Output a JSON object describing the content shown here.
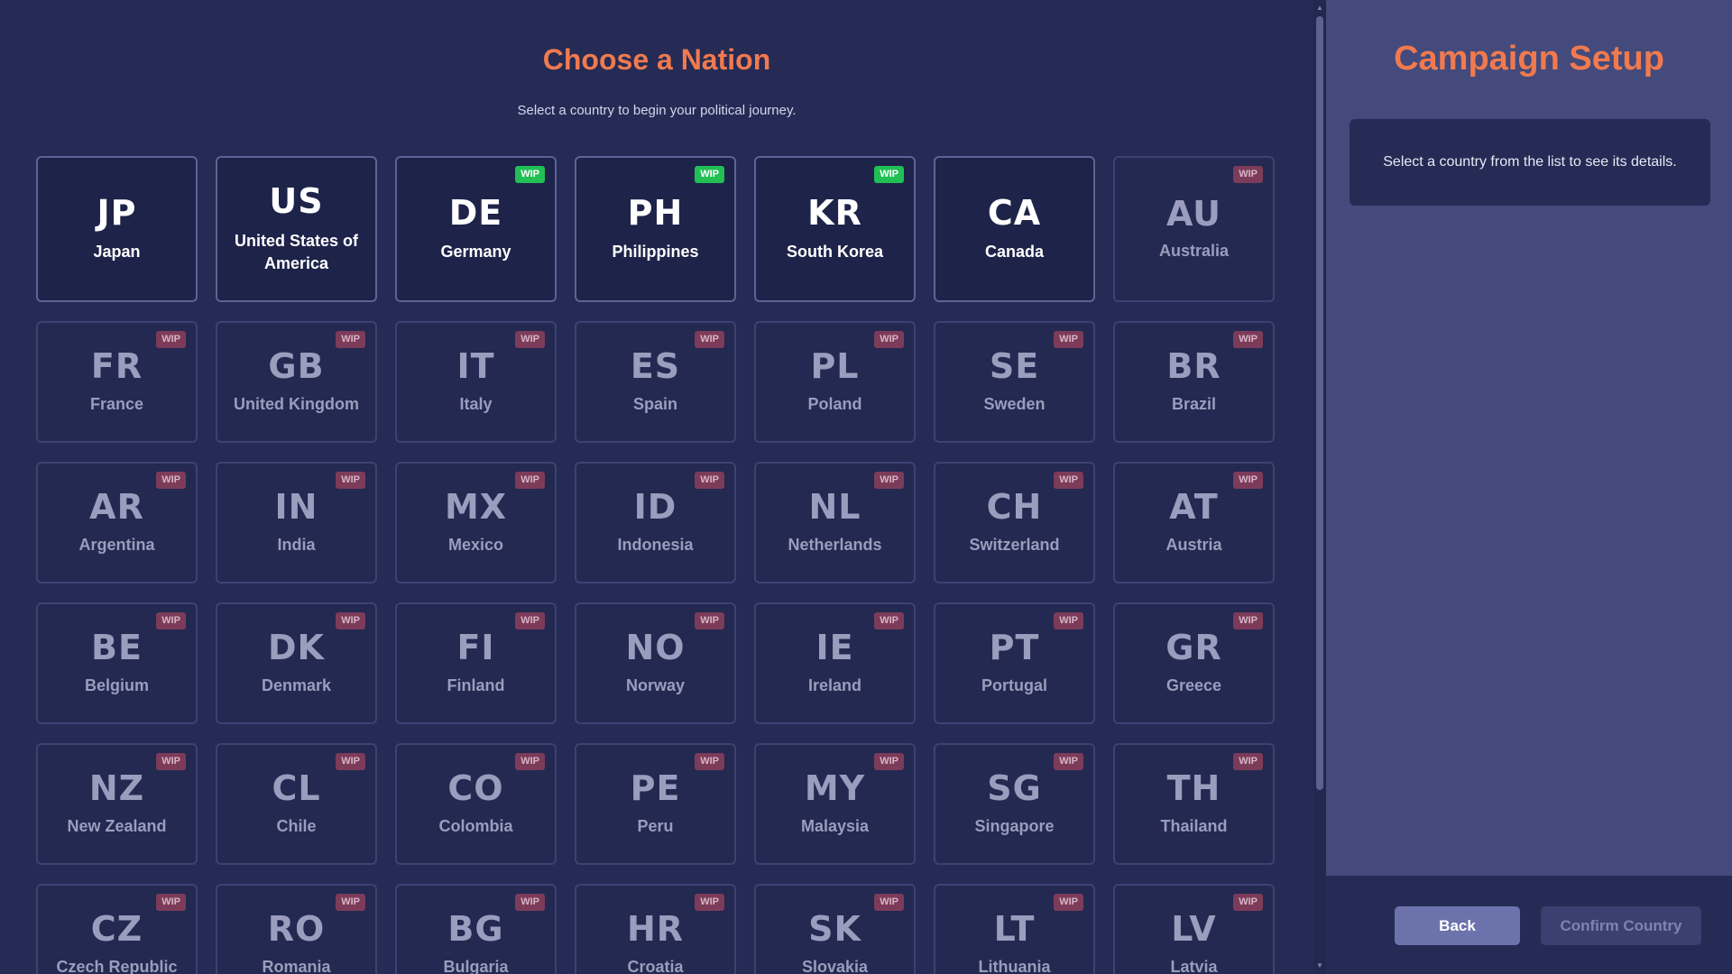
{
  "main": {
    "title": "Choose a Nation",
    "subtitle": "Select a country to begin your political journey."
  },
  "countries": [
    {
      "code": "JP",
      "name": "Japan",
      "active": true,
      "badge": ""
    },
    {
      "code": "US",
      "name": "United States of America",
      "active": true,
      "badge": ""
    },
    {
      "code": "DE",
      "name": "Germany",
      "active": true,
      "badge": "WIP",
      "badge_color": "green"
    },
    {
      "code": "PH",
      "name": "Philippines",
      "active": true,
      "badge": "WIP",
      "badge_color": "green"
    },
    {
      "code": "KR",
      "name": "South Korea",
      "active": true,
      "badge": "WIP",
      "badge_color": "green"
    },
    {
      "code": "CA",
      "name": "Canada",
      "active": true,
      "badge": ""
    },
    {
      "code": "AU",
      "name": "Australia",
      "active": false,
      "badge": "WIP",
      "badge_color": "red"
    },
    {
      "code": "FR",
      "name": "France",
      "active": false,
      "badge": "WIP",
      "badge_color": "red"
    },
    {
      "code": "GB",
      "name": "United Kingdom",
      "active": false,
      "badge": "WIP",
      "badge_color": "red"
    },
    {
      "code": "IT",
      "name": "Italy",
      "active": false,
      "badge": "WIP",
      "badge_color": "red"
    },
    {
      "code": "ES",
      "name": "Spain",
      "active": false,
      "badge": "WIP",
      "badge_color": "red"
    },
    {
      "code": "PL",
      "name": "Poland",
      "active": false,
      "badge": "WIP",
      "badge_color": "red"
    },
    {
      "code": "SE",
      "name": "Sweden",
      "active": false,
      "badge": "WIP",
      "badge_color": "red"
    },
    {
      "code": "BR",
      "name": "Brazil",
      "active": false,
      "badge": "WIP",
      "badge_color": "red"
    },
    {
      "code": "AR",
      "name": "Argentina",
      "active": false,
      "badge": "WIP",
      "badge_color": "red"
    },
    {
      "code": "IN",
      "name": "India",
      "active": false,
      "badge": "WIP",
      "badge_color": "red"
    },
    {
      "code": "MX",
      "name": "Mexico",
      "active": false,
      "badge": "WIP",
      "badge_color": "red"
    },
    {
      "code": "ID",
      "name": "Indonesia",
      "active": false,
      "badge": "WIP",
      "badge_color": "red"
    },
    {
      "code": "NL",
      "name": "Netherlands",
      "active": false,
      "badge": "WIP",
      "badge_color": "red"
    },
    {
      "code": "CH",
      "name": "Switzerland",
      "active": false,
      "badge": "WIP",
      "badge_color": "red"
    },
    {
      "code": "AT",
      "name": "Austria",
      "active": false,
      "badge": "WIP",
      "badge_color": "red"
    },
    {
      "code": "BE",
      "name": "Belgium",
      "active": false,
      "badge": "WIP",
      "badge_color": "red"
    },
    {
      "code": "DK",
      "name": "Denmark",
      "active": false,
      "badge": "WIP",
      "badge_color": "red"
    },
    {
      "code": "FI",
      "name": "Finland",
      "active": false,
      "badge": "WIP",
      "badge_color": "red"
    },
    {
      "code": "NO",
      "name": "Norway",
      "active": false,
      "badge": "WIP",
      "badge_color": "red"
    },
    {
      "code": "IE",
      "name": "Ireland",
      "active": false,
      "badge": "WIP",
      "badge_color": "red"
    },
    {
      "code": "PT",
      "name": "Portugal",
      "active": false,
      "badge": "WIP",
      "badge_color": "red"
    },
    {
      "code": "GR",
      "name": "Greece",
      "active": false,
      "badge": "WIP",
      "badge_color": "red"
    },
    {
      "code": "NZ",
      "name": "New Zealand",
      "active": false,
      "badge": "WIP",
      "badge_color": "red"
    },
    {
      "code": "CL",
      "name": "Chile",
      "active": false,
      "badge": "WIP",
      "badge_color": "red"
    },
    {
      "code": "CO",
      "name": "Colombia",
      "active": false,
      "badge": "WIP",
      "badge_color": "red"
    },
    {
      "code": "PE",
      "name": "Peru",
      "active": false,
      "badge": "WIP",
      "badge_color": "red"
    },
    {
      "code": "MY",
      "name": "Malaysia",
      "active": false,
      "badge": "WIP",
      "badge_color": "red"
    },
    {
      "code": "SG",
      "name": "Singapore",
      "active": false,
      "badge": "WIP",
      "badge_color": "red"
    },
    {
      "code": "TH",
      "name": "Thailand",
      "active": false,
      "badge": "WIP",
      "badge_color": "red"
    },
    {
      "code": "CZ",
      "name": "Czech Republic",
      "active": false,
      "badge": "WIP",
      "badge_color": "red"
    },
    {
      "code": "RO",
      "name": "Romania",
      "active": false,
      "badge": "WIP",
      "badge_color": "red"
    },
    {
      "code": "BG",
      "name": "Bulgaria",
      "active": false,
      "badge": "WIP",
      "badge_color": "red"
    },
    {
      "code": "HR",
      "name": "Croatia",
      "active": false,
      "badge": "WIP",
      "badge_color": "red"
    },
    {
      "code": "SK",
      "name": "Slovakia",
      "active": false,
      "badge": "WIP",
      "badge_color": "red"
    },
    {
      "code": "LT",
      "name": "Lithuania",
      "active": false,
      "badge": "WIP",
      "badge_color": "red"
    },
    {
      "code": "LV",
      "name": "Latvia",
      "active": false,
      "badge": "WIP",
      "badge_color": "red"
    }
  ],
  "panel": {
    "title": "Campaign Setup",
    "details_placeholder": "Select a country from the list to see its details.",
    "back_label": "Back",
    "confirm_label": "Confirm Country"
  },
  "colors": {
    "accent": "#f07a4e",
    "background": "#252b55",
    "panel": "#444a7c",
    "wip_green": "#22bf55",
    "wip_red": "#7d3b5a"
  },
  "icons": {
    "scroll_up": "caret-up-icon",
    "scroll_down": "caret-down-icon"
  }
}
